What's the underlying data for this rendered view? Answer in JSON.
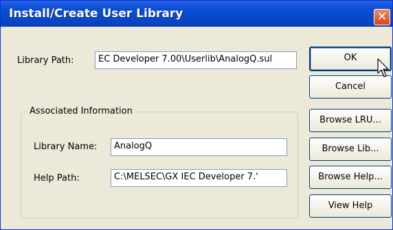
{
  "window": {
    "title": "Install/Create User Library",
    "close_glyph": "✕"
  },
  "library_path": {
    "label": "Library Path:",
    "value": "EC Developer 7.00\\Userlib\\AnalogQ.sul"
  },
  "associated": {
    "legend": "Associated Information",
    "library_name_label": "Library Name:",
    "library_name_value": "AnalogQ",
    "help_path_label": "Help Path:",
    "help_path_value": "C:\\MELSEC\\GX IEC Developer 7.'"
  },
  "buttons": {
    "ok": "OK",
    "cancel": "Cancel",
    "browse_lru": "Browse LRU...",
    "browse_lib": "Browse Lib...",
    "browse_help": "Browse Help...",
    "view_help": "View Help"
  },
  "icons": {
    "cursor": "mouse-pointer-icon",
    "close": "close-icon"
  }
}
